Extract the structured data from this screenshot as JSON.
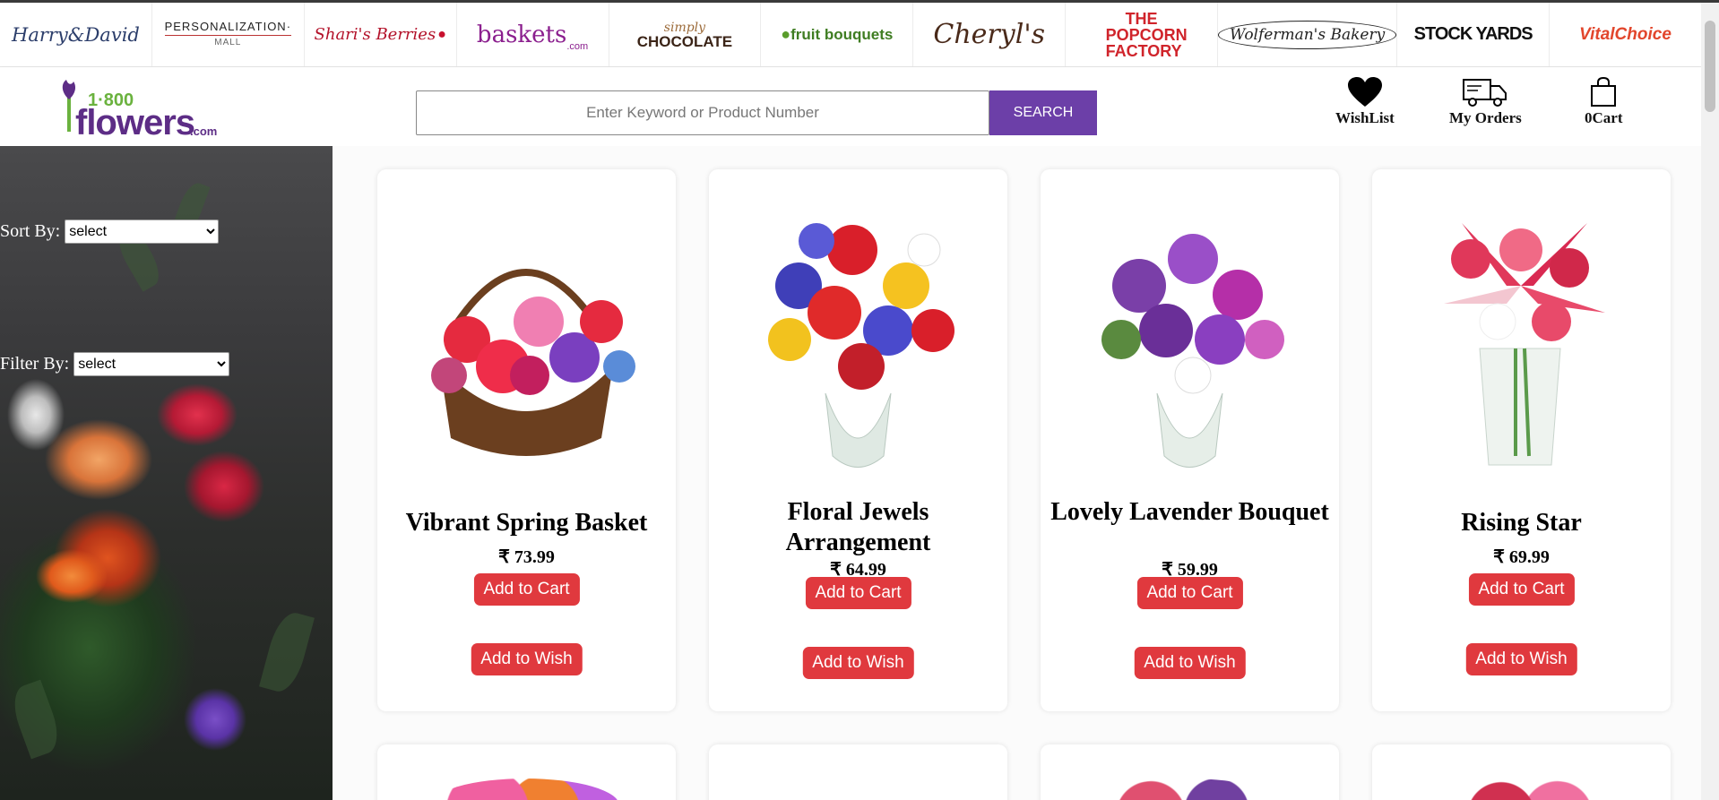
{
  "brands": [
    {
      "id": "harry-david",
      "label": "Harry&David"
    },
    {
      "id": "personalization-mall",
      "label": "PERSONALIZATION·",
      "sub": "MALL"
    },
    {
      "id": "sharis-berries",
      "label": "Shari's Berries"
    },
    {
      "id": "1800-baskets",
      "label": "baskets",
      "sub": ".com"
    },
    {
      "id": "simply-chocolate",
      "label": "CHOCOLATE",
      "sub": "simply"
    },
    {
      "id": "fruit-bouquets",
      "label": "fruit bouquets"
    },
    {
      "id": "cheryls",
      "label": "Cheryl's"
    },
    {
      "id": "popcorn-factory",
      "label": "THE POPCORN FACTORY"
    },
    {
      "id": "wolfermans",
      "label": "Wolferman's Bakery"
    },
    {
      "id": "stock-yards",
      "label": "STOCK YARDS"
    },
    {
      "id": "vital-choice",
      "label": "VitalChoice"
    }
  ],
  "header": {
    "logo": {
      "num": "1·800",
      "word": "flowers",
      "com": ".com"
    },
    "search": {
      "placeholder": "Enter Keyword or Product Number",
      "button": "SEARCH"
    },
    "wishlist": "WishList",
    "orders": "My Orders",
    "cart": "0Cart"
  },
  "sidebar": {
    "sort_label": "Sort By:",
    "sort_value": "select",
    "filter_label": "Filter By:",
    "filter_value": "select"
  },
  "products": [
    {
      "name": "Vibrant Spring Basket",
      "price": "₹ 73.99",
      "add_cart": "Add to Cart",
      "add_wish": "Add to Wish"
    },
    {
      "name": "Floral Jewels Arrangement",
      "price": "₹ 64.99",
      "add_cart": "Add to Cart",
      "add_wish": "Add to Wish"
    },
    {
      "name": "Lovely Lavender Bouquet",
      "price": "₹ 59.99",
      "add_cart": "Add to Cart",
      "add_wish": "Add to Wish"
    },
    {
      "name": "Rising Star",
      "price": "₹ 69.99",
      "add_cart": "Add to Cart",
      "add_wish": "Add to Wish"
    }
  ],
  "colors": {
    "search_button": "#6c3fa8",
    "action_button": "#e0393e",
    "logo_purple": "#5d2d86",
    "logo_green": "#6ab23e"
  }
}
